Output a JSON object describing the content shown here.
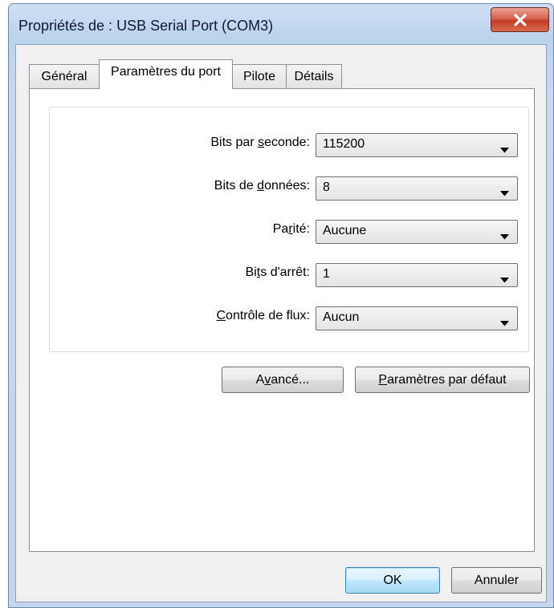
{
  "window": {
    "title": "Propriétés de : USB Serial Port (COM3)"
  },
  "tabs": [
    {
      "label": "Général",
      "active": false
    },
    {
      "label": "Paramètres du port",
      "active": true
    },
    {
      "label": "Pilote",
      "active": false
    },
    {
      "label": "Détails",
      "active": false
    }
  ],
  "settings": [
    {
      "label_pre": "Bits par ",
      "label_key": "s",
      "label_post": "econde:",
      "value": "115200"
    },
    {
      "label_pre": "Bits de ",
      "label_key": "d",
      "label_post": "onnées:",
      "value": "8"
    },
    {
      "label_pre": "Pa",
      "label_key": "r",
      "label_post": "ité:",
      "value": "Aucune"
    },
    {
      "label_pre": "Bi",
      "label_key": "t",
      "label_post": "s d'arrêt:",
      "value": "1"
    },
    {
      "label_pre": "",
      "label_key": "C",
      "label_post": "ontrôle de flux:",
      "value": "Aucun"
    }
  ],
  "buttons": {
    "advanced": {
      "pre": "A",
      "key": "v",
      "post": "ancé..."
    },
    "defaults": {
      "pre": "",
      "key": "P",
      "post": "aramètres par défaut"
    },
    "ok": "OK",
    "cancel": "Annuler"
  },
  "icons": {
    "close": "close-icon",
    "dropdown": "chevron-down-icon"
  },
  "colors": {
    "close_button": "#c8432b",
    "default_button_border": "#3c7fb1",
    "title_bar": "#c6d9ef"
  }
}
